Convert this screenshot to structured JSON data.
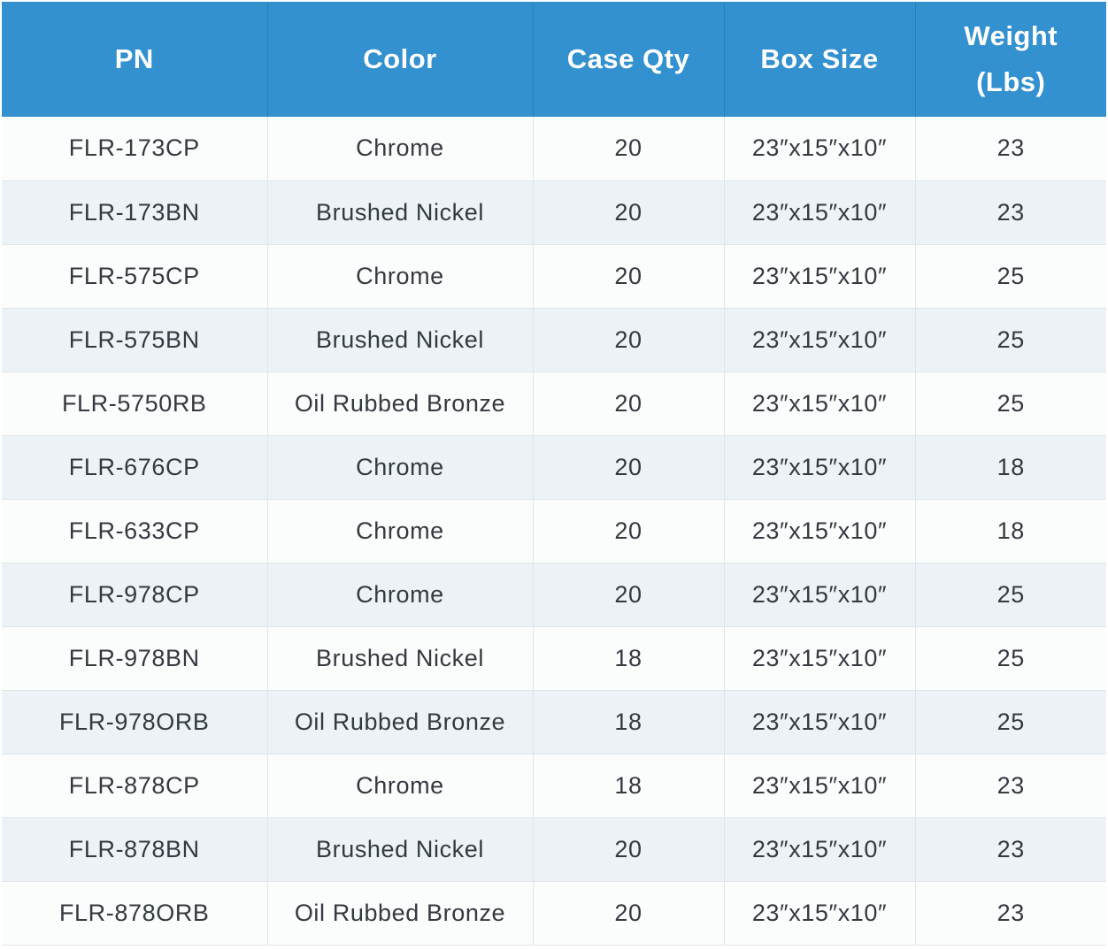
{
  "table": {
    "header": {
      "pn": "PN",
      "color": "Color",
      "case_qty": "Case Qty",
      "box_size": "Box Size",
      "weight_line1": "Weight",
      "weight_line2": "(Lbs)"
    },
    "rows": [
      {
        "pn": "FLR-173CP",
        "color": "Chrome",
        "case_qty": "20",
        "box_size": "23″x15″x10″",
        "weight": "23"
      },
      {
        "pn": "FLR-173BN",
        "color": "Brushed Nickel",
        "case_qty": "20",
        "box_size": "23″x15″x10″",
        "weight": "23"
      },
      {
        "pn": "FLR-575CP",
        "color": "Chrome",
        "case_qty": "20",
        "box_size": "23″x15″x10″",
        "weight": "25"
      },
      {
        "pn": "FLR-575BN",
        "color": "Brushed Nickel",
        "case_qty": "20",
        "box_size": "23″x15″x10″",
        "weight": "25"
      },
      {
        "pn": "FLR-5750RB",
        "color": "Oil Rubbed Bronze",
        "case_qty": "20",
        "box_size": "23″x15″x10″",
        "weight": "25"
      },
      {
        "pn": "FLR-676CP",
        "color": "Chrome",
        "case_qty": "20",
        "box_size": "23″x15″x10″",
        "weight": "18"
      },
      {
        "pn": "FLR-633CP",
        "color": "Chrome",
        "case_qty": "20",
        "box_size": "23″x15″x10″",
        "weight": "18"
      },
      {
        "pn": "FLR-978CP",
        "color": "Chrome",
        "case_qty": "20",
        "box_size": "23″x15″x10″",
        "weight": "25"
      },
      {
        "pn": "FLR-978BN",
        "color": "Brushed Nickel",
        "case_qty": "18",
        "box_size": "23″x15″x10″",
        "weight": "25"
      },
      {
        "pn": "FLR-978ORB",
        "color": "Oil Rubbed Bronze",
        "case_qty": "18",
        "box_size": "23″x15″x10″",
        "weight": "25"
      },
      {
        "pn": "FLR-878CP",
        "color": "Chrome",
        "case_qty": "18",
        "box_size": "23″x15″x10″",
        "weight": "23"
      },
      {
        "pn": "FLR-878BN",
        "color": "Brushed Nickel",
        "case_qty": "20",
        "box_size": "23″x15″x10″",
        "weight": "23"
      },
      {
        "pn": "FLR-878ORB",
        "color": "Oil Rubbed Bronze",
        "case_qty": "20",
        "box_size": "23″x15″x10″",
        "weight": "23"
      }
    ]
  },
  "colors": {
    "header_bg": "#3391cf",
    "header_text": "#ffffff",
    "row_odd_bg": "#fbfcfc",
    "row_even_bg": "#ecf2f5",
    "cell_text": "#333a40"
  }
}
